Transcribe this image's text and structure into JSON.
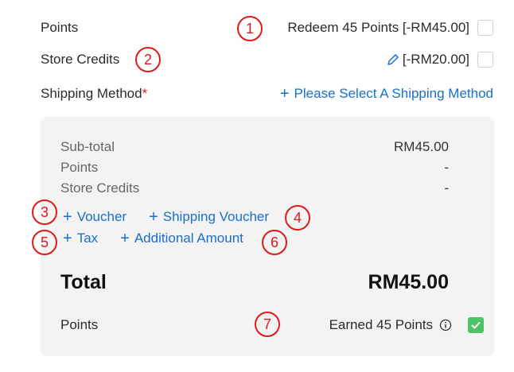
{
  "points_row": {
    "label": "Points",
    "action": "Redeem 45 Points [-RM45.00]"
  },
  "credits_row": {
    "label": "Store Credits",
    "action": "[-RM20.00]"
  },
  "shipping_row": {
    "label": "Shipping Method",
    "required": "*",
    "action": "Please Select A Shipping Method"
  },
  "summary": {
    "rows": [
      {
        "label": "Sub-total",
        "value": "RM45.00"
      },
      {
        "label": "Points",
        "value": "-"
      },
      {
        "label": "Store Credits",
        "value": "-"
      }
    ],
    "links": [
      "Voucher",
      "Shipping Voucher",
      "Tax",
      "Additional Amount"
    ],
    "total_label": "Total",
    "total_value": "RM45.00",
    "points_label": "Points",
    "earned_text": "Earned 45 Points"
  },
  "markers": [
    "1",
    "2",
    "3",
    "4",
    "5",
    "6",
    "7"
  ],
  "colors": {
    "link": "#1a6fc9",
    "marker": "#e01919",
    "check": "#4cc466",
    "panel": "#f3f3f3"
  }
}
